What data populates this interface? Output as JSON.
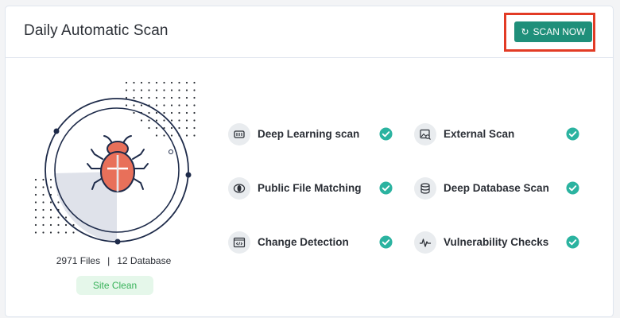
{
  "card": {
    "title": "Daily Automatic Scan",
    "scan_button_label": "SCAN NOW"
  },
  "summary": {
    "files": "2971 Files",
    "separator": "|",
    "databases": "12 Database",
    "status": "Site Clean"
  },
  "features": [
    {
      "label": "Deep Learning scan",
      "icon": "chip-icon",
      "checked": true
    },
    {
      "label": "External Scan",
      "icon": "image-search-icon",
      "checked": true
    },
    {
      "label": "Public File Matching",
      "icon": "eye-icon",
      "checked": true
    },
    {
      "label": "Deep Database Scan",
      "icon": "database-icon",
      "checked": true
    },
    {
      "label": "Change Detection",
      "icon": "code-window-icon",
      "checked": true
    },
    {
      "label": "Vulnerability Checks",
      "icon": "pulse-icon",
      "checked": true
    }
  ],
  "colors": {
    "accent": "#1f8f7a",
    "check": "#2bb3a0",
    "bug": "#e8705a",
    "highlight": "#e23b25",
    "badge_text": "#38b25a"
  }
}
